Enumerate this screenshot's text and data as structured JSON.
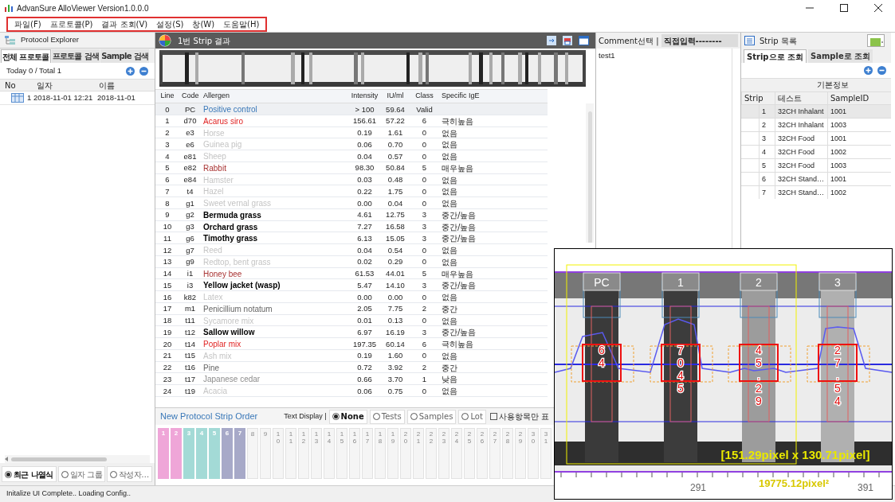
{
  "window": {
    "title": "AdvanSure AlloViewer Version1.0.0.0"
  },
  "menu": [
    {
      "label": "파일(F)"
    },
    {
      "label": "프로토콜(P)"
    },
    {
      "label": "결과 조회(V)"
    },
    {
      "label": "설정(S)"
    },
    {
      "label": "창(W)"
    },
    {
      "label": "도움말(H)"
    }
  ],
  "protocol_explorer": {
    "title": "Protocol Explorer",
    "tabs": [
      {
        "label": "전체 프로토콜",
        "selected": true
      },
      {
        "label": "프로토콜 검색",
        "selected": false
      },
      {
        "label": "Sample 검색",
        "selected": false
      }
    ],
    "summary": "Today 0 / Total 1",
    "columns": [
      "No",
      "일자",
      "이름"
    ],
    "rows": [
      {
        "no": "1",
        "date": "2018-11-01 12:21",
        "name": "2018-11-01"
      }
    ],
    "view_options": [
      {
        "label": "최근 나열식",
        "selected": true
      },
      {
        "label": "일자 그룹",
        "selected": false
      },
      {
        "label": "작성자…",
        "selected": false
      }
    ]
  },
  "result": {
    "title": "1번 Strip 결과",
    "columns": [
      "Line",
      "Code",
      "Allergen",
      "Intensity",
      "IU/ml",
      "Class",
      "Specific IgE"
    ],
    "rows": [
      {
        "line": "0",
        "code": "PC",
        "allergen": "Positive control",
        "intensity": "> 100",
        "iu": "59.64",
        "class": "Valid",
        "color": "#3a78b8",
        "selected": true
      },
      {
        "line": "1",
        "code": "d70",
        "allergen": "Acarus siro",
        "intensity": "156.61",
        "iu": "57.22",
        "class": "6",
        "ige": "극히높음",
        "color": "#e02424",
        "selected": false
      },
      {
        "line": "2",
        "code": "e3",
        "allergen": "Horse",
        "intensity": "0.19",
        "iu": "1.61",
        "class": "0",
        "ige": "없음",
        "color": "#c4c4c4",
        "selected": false
      },
      {
        "line": "3",
        "code": "e6",
        "allergen": "Guinea pig",
        "intensity": "0.06",
        "iu": "0.70",
        "class": "0",
        "ige": "없음",
        "color": "#c4c4c4",
        "selected": false
      },
      {
        "line": "4",
        "code": "e81",
        "allergen": "Sheep",
        "intensity": "0.04",
        "iu": "0.57",
        "class": "0",
        "ige": "없음",
        "color": "#c4c4c4",
        "selected": false
      },
      {
        "line": "5",
        "code": "e82",
        "allergen": "Rabbit",
        "intensity": "98.30",
        "iu": "50.84",
        "class": "5",
        "ige": "매우높음",
        "color": "#a83232",
        "selected": false
      },
      {
        "line": "6",
        "code": "e84",
        "allergen": "Hamster",
        "intensity": "0.03",
        "iu": "0.48",
        "class": "0",
        "ige": "없음",
        "color": "#c4c4c4",
        "selected": false
      },
      {
        "line": "7",
        "code": "t4",
        "allergen": "Hazel",
        "intensity": "0.22",
        "iu": "1.75",
        "class": "0",
        "ige": "없음",
        "color": "#c4c4c4",
        "selected": false
      },
      {
        "line": "8",
        "code": "g1",
        "allergen": "Sweet vernal grass",
        "intensity": "0.00",
        "iu": "0.04",
        "class": "0",
        "ige": "없음",
        "color": "#c4c4c4",
        "selected": false
      },
      {
        "line": "9",
        "code": "g2",
        "allergen": "Bermuda grass",
        "intensity": "4.61",
        "iu": "12.75",
        "class": "3",
        "ige": "중간/높음",
        "color": "#000000",
        "selected": false
      },
      {
        "line": "10",
        "code": "g3",
        "allergen": "Orchard grass",
        "intensity": "7.27",
        "iu": "16.58",
        "class": "3",
        "ige": "중간/높음",
        "color": "#000000",
        "selected": false
      },
      {
        "line": "11",
        "code": "g6",
        "allergen": "Timothy grass",
        "intensity": "6.13",
        "iu": "15.05",
        "class": "3",
        "ige": "중간/높음",
        "color": "#000000",
        "selected": false
      },
      {
        "line": "12",
        "code": "g7",
        "allergen": "Reed",
        "intensity": "0.04",
        "iu": "0.54",
        "class": "0",
        "ige": "없음",
        "color": "#c4c4c4",
        "selected": false
      },
      {
        "line": "13",
        "code": "g9",
        "allergen": "Redtop, bent grass",
        "intensity": "0.02",
        "iu": "0.29",
        "class": "0",
        "ige": "없음",
        "color": "#c4c4c4",
        "selected": false
      },
      {
        "line": "14",
        "code": "i1",
        "allergen": "Honey bee",
        "intensity": "61.53",
        "iu": "44.01",
        "class": "5",
        "ige": "매우높음",
        "color": "#a83232",
        "selected": false
      },
      {
        "line": "15",
        "code": "i3",
        "allergen": "Yellow jacket (wasp)",
        "intensity": "5.47",
        "iu": "14.10",
        "class": "3",
        "ige": "중간/높음",
        "color": "#000000",
        "selected": false
      },
      {
        "line": "16",
        "code": "k82",
        "allergen": "Latex",
        "intensity": "0.00",
        "iu": "0.00",
        "class": "0",
        "ige": "없음",
        "color": "#c4c4c4",
        "selected": false
      },
      {
        "line": "17",
        "code": "m1",
        "allergen": "Penicillium notatum",
        "intensity": "2.05",
        "iu": "7.75",
        "class": "2",
        "ige": "중간",
        "color": "#666666",
        "selected": false
      },
      {
        "line": "18",
        "code": "t11",
        "allergen": "Sycamore mix",
        "intensity": "0.01",
        "iu": "0.13",
        "class": "0",
        "ige": "없음",
        "color": "#c4c4c4",
        "selected": false
      },
      {
        "line": "19",
        "code": "t12",
        "allergen": "Sallow willow",
        "intensity": "6.97",
        "iu": "16.19",
        "class": "3",
        "ige": "중간/높음",
        "color": "#000000",
        "selected": false
      },
      {
        "line": "20",
        "code": "t14",
        "allergen": "Poplar mix",
        "intensity": "197.35",
        "iu": "60.14",
        "class": "6",
        "ige": "극히높음",
        "color": "#e02424",
        "selected": false
      },
      {
        "line": "21",
        "code": "t15",
        "allergen": "Ash mix",
        "intensity": "0.19",
        "iu": "1.60",
        "class": "0",
        "ige": "없음",
        "color": "#c4c4c4",
        "selected": false
      },
      {
        "line": "22",
        "code": "t16",
        "allergen": "Pine",
        "intensity": "0.72",
        "iu": "3.92",
        "class": "2",
        "ige": "중간",
        "color": "#666666",
        "selected": false
      },
      {
        "line": "23",
        "code": "t17",
        "allergen": "Japanese cedar",
        "intensity": "0.66",
        "iu": "3.70",
        "class": "1",
        "ige": "낮음",
        "color": "#8c8c8c",
        "selected": false
      },
      {
        "line": "24",
        "code": "t19",
        "allergen": "Acacia",
        "intensity": "0.06",
        "iu": "0.75",
        "class": "0",
        "ige": "없음",
        "color": "#c4c4c4",
        "selected": false
      }
    ]
  },
  "strip_order": {
    "title": "New Protocol Strip Order",
    "text_display_label": "Text Display |",
    "text_display": [
      {
        "label": "None",
        "selected": true
      },
      {
        "label": "Tests",
        "selected": false
      },
      {
        "label": "Samples",
        "selected": false
      },
      {
        "label": "Lot",
        "selected": false
      }
    ],
    "used_only": {
      "label": "사용항목만 표",
      "checked": false
    },
    "slots": [
      {
        "label": "1",
        "color": "#efa6d8"
      },
      {
        "label": "2",
        "color": "#efa6d8"
      },
      {
        "label": "3",
        "color": "#a3dad6"
      },
      {
        "label": "4",
        "color": "#a3dad6"
      },
      {
        "label": "5",
        "color": "#a3dad6"
      },
      {
        "label": "6",
        "color": "#a7a9c8"
      },
      {
        "label": "7",
        "color": "#a7a9c8"
      },
      {
        "label": "8"
      },
      {
        "label": "9"
      },
      {
        "label": "10"
      },
      {
        "label": "11"
      },
      {
        "label": "12"
      },
      {
        "label": "13"
      },
      {
        "label": "14"
      },
      {
        "label": "15"
      },
      {
        "label": "16"
      },
      {
        "label": "17"
      },
      {
        "label": "18"
      },
      {
        "label": "19"
      },
      {
        "label": "20"
      },
      {
        "label": "21"
      },
      {
        "label": "22"
      },
      {
        "label": "23"
      },
      {
        "label": "24"
      },
      {
        "label": "25"
      },
      {
        "label": "26"
      },
      {
        "label": "27"
      },
      {
        "label": "28"
      },
      {
        "label": "29"
      },
      {
        "label": "30"
      },
      {
        "label": "31"
      }
    ]
  },
  "comment": {
    "label": "Comment선택 |",
    "preset": "직접입력--------",
    "text": "test1"
  },
  "strip_list": {
    "title": "Strip 목록",
    "tabs": [
      {
        "label": "Strip으로 조회",
        "selected": true
      },
      {
        "label": "Sample로 조회",
        "selected": false
      }
    ],
    "group_header": "기본정보",
    "columns": [
      "Strip",
      "테스트",
      "SampleID"
    ],
    "rows": [
      {
        "strip": "1",
        "test": "32CH Inhalant",
        "sample_id": "1001",
        "selected": true
      },
      {
        "strip": "2",
        "test": "32CH Inhalant",
        "sample_id": "1003",
        "selected": false
      },
      {
        "strip": "3",
        "test": "32CH Food",
        "sample_id": "1001",
        "selected": false
      },
      {
        "strip": "4",
        "test": "32CH Food",
        "sample_id": "1002",
        "selected": false
      },
      {
        "strip": "5",
        "test": "32CH Food",
        "sample_id": "1003",
        "selected": false
      },
      {
        "strip": "6",
        "test": "32CH Stand…",
        "sample_id": "1001",
        "selected": false
      },
      {
        "strip": "7",
        "test": "32CH Stand…",
        "sample_id": "1002",
        "selected": false
      }
    ]
  },
  "scan_inset": {
    "lanes": [
      {
        "label": "PC",
        "value": "64"
      },
      {
        "label": "1",
        "value": "7045"
      },
      {
        "label": "2",
        "value": "45.29"
      },
      {
        "label": "3",
        "value": "27.54"
      }
    ],
    "measurement": "[151.29pixel x 130.71pixel]",
    "area": "19775.12pixel²",
    "axis_labels": [
      "291",
      "391"
    ]
  },
  "status_bar": {
    "message": "Initalize UI Complete.. Loading Config.."
  }
}
